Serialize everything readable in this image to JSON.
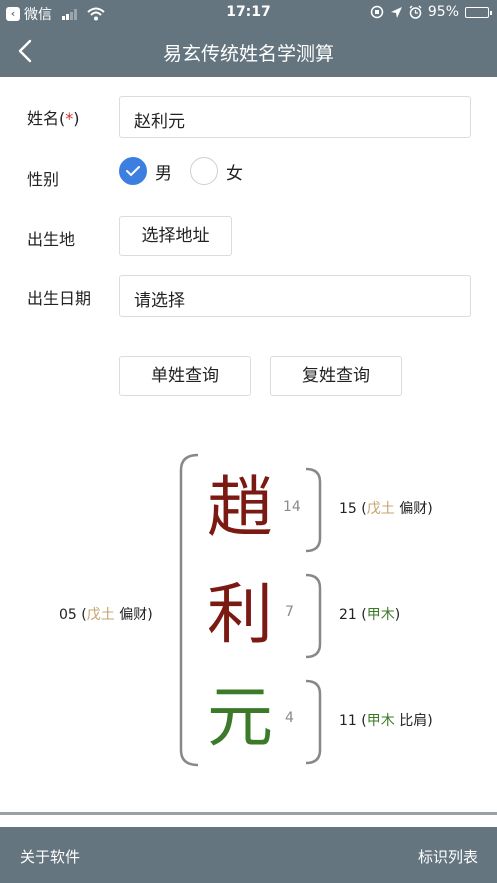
{
  "status_bar": {
    "back_app": "微信",
    "time": "17:17",
    "battery": "95%",
    "battery_level": 0.95
  },
  "navbar": {
    "title": "易玄传统姓名学测算",
    "back_icon": "chevron-left-icon"
  },
  "form": {
    "name_label": "姓名(",
    "name_required": "*",
    "name_label_close": ")",
    "name_value": "赵利元",
    "gender_label": "性别",
    "gender_options": [
      {
        "label": "男",
        "selected": true
      },
      {
        "label": "女",
        "selected": false
      }
    ],
    "birthplace_label": "出生地",
    "birthplace_button": "选择地址",
    "birthdate_label": "出生日期",
    "birthdate_placeholder": "请选择",
    "single_surname_button": "单姓查询",
    "compound_surname_button": "复姓查询"
  },
  "analysis": {
    "characters": [
      {
        "char": "趙",
        "strokes": "14",
        "color": "#7a1a12"
      },
      {
        "char": "利",
        "strokes": "7",
        "color": "#7a1a12"
      },
      {
        "char": "元",
        "strokes": "4",
        "color": "#3c7a2a"
      }
    ],
    "grids": [
      {
        "number": "15",
        "element": "戊土",
        "element_color": "#c4a46c",
        "relation": "偏财"
      },
      {
        "number": "21",
        "element": "甲木",
        "element_color": "#3c7a2a",
        "relation": ""
      },
      {
        "number": "11",
        "element": "甲木",
        "element_color": "#3c7a2a",
        "relation": "比肩"
      }
    ],
    "outer": {
      "number": "05",
      "element": "戊土",
      "element_color": "#c4a46c",
      "relation": "偏财"
    }
  },
  "footer": {
    "about": "关于软件",
    "legend": "标识列表"
  }
}
